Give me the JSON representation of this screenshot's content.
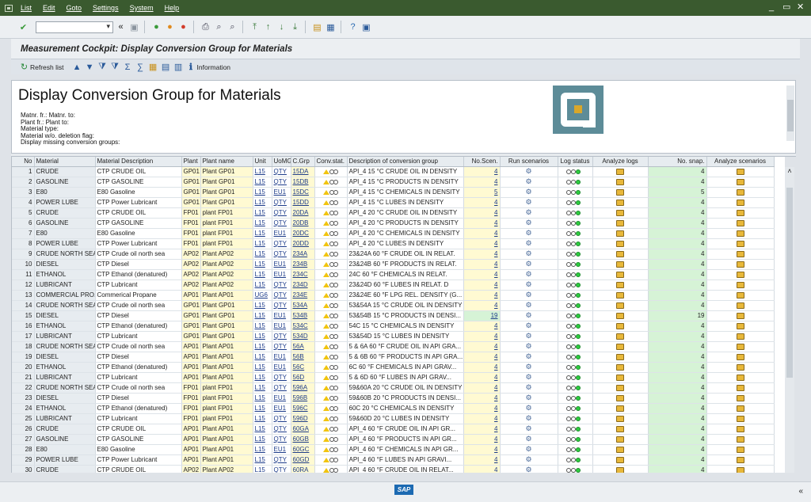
{
  "menu": [
    "List",
    "Edit",
    "Goto",
    "Settings",
    "System",
    "Help"
  ],
  "window_controls": [
    "_",
    "▭",
    "✕"
  ],
  "title": "Measurement Cockpit: Display Conversion Group for Materials",
  "app_toolbar": {
    "refresh": "Refresh list",
    "information": "Information"
  },
  "header": {
    "heading": "Display Conversion Group for Materials",
    "criteria": [
      "Matnr. fr.: Matnr. to:",
      "Plant fr.: Plant to:",
      "Material type:",
      "Material w/o. deletion flag:",
      "Display missing conversion groups:"
    ]
  },
  "columns": [
    "No",
    "Material",
    "Material Description",
    "Plant",
    "Plant name",
    "Unit",
    "UoMG",
    "C.Grp",
    "Conv.stat.",
    "Description of conversion group",
    "No.Scen.",
    "Run scenarios",
    "Log status",
    "Analyze logs",
    "No. snap.",
    "Analyze scenarios"
  ],
  "rows": [
    [
      "1",
      "CRUDE",
      "CTP CRUDE OIL",
      "GP01",
      "Plant GP01",
      "L15",
      "QTY",
      "15DA",
      "API_4  15 °C CRUDE OIL  IN DENSITY",
      "4",
      "4"
    ],
    [
      "2",
      "GASOLINE",
      "CTP GASOLINE",
      "GP01",
      "Plant GP01",
      "L15",
      "QTY",
      "15DB",
      "API_4  15 °C PRODUCTS  IN DENSITY",
      "4",
      "4"
    ],
    [
      "3",
      "E80",
      "E80 Gasoline",
      "GP01",
      "Plant GP01",
      "L15",
      "EU1",
      "15DC",
      "API_4  15 °C CHEMICALS IN DENSITY",
      "5",
      "5"
    ],
    [
      "4",
      "POWER LUBE",
      "CTP Power Lubricant",
      "GP01",
      "Plant GP01",
      "L15",
      "QTY",
      "15DD",
      "API_4  15 °C LUBES     IN DENSITY",
      "4",
      "4"
    ],
    [
      "5",
      "CRUDE",
      "CTP CRUDE OIL",
      "FP01",
      "plant FP01",
      "L15",
      "QTY",
      "20DA",
      "API_4  20 °C CRUDE OIL  IN DENSITY",
      "4",
      "4"
    ],
    [
      "6",
      "GASOLINE",
      "CTP GASOLINE",
      "FP01",
      "plant FP01",
      "L15",
      "QTY",
      "20DB",
      "API_4  20 °C PRODUCTS  IN DENSITY",
      "4",
      "4"
    ],
    [
      "7",
      "E80",
      "E80 Gasoline",
      "FP01",
      "plant FP01",
      "L15",
      "EU1",
      "20DC",
      "API_4  20 °C CHEMICALS IN DENSITY",
      "4",
      "4"
    ],
    [
      "8",
      "POWER LUBE",
      "CTP Power Lubricant",
      "FP01",
      "plant FP01",
      "L15",
      "QTY",
      "20DD",
      "API_4  20 °C LUBES     IN DENSITY",
      "4",
      "4"
    ],
    [
      "9",
      "CRUDE NORTH SEA",
      "CTP Crude oil north sea",
      "AP02",
      "Plant AP02",
      "L15",
      "QTY",
      "234A",
      "23&24A 60 °F CRUDE OIL  IN RELAT.",
      "4",
      "4"
    ],
    [
      "10",
      "DIESEL",
      "CTP Diesel",
      "AP02",
      "Plant AP02",
      "L15",
      "EU1",
      "234B",
      "23&24B 60 °F PRODUCTS   IN RELAT.",
      "4",
      "4"
    ],
    [
      "11",
      "ETHANOL",
      "CTP Ethanol (denatured)",
      "AP02",
      "Plant AP02",
      "L15",
      "EU1",
      "234C",
      "24C    60 °F CHEMICALS IN RELAT.",
      "4",
      "4"
    ],
    [
      "12",
      "LUBRICANT",
      "CTP Lubricant",
      "AP02",
      "Plant AP02",
      "L15",
      "QTY",
      "234D",
      "23&24D 60 °F LUBES      IN RELAT. D",
      "4",
      "4"
    ],
    [
      "13",
      "COMMERCIAL PRO...",
      "Commerical Propane",
      "AP01",
      "Plant AP01",
      "UG6",
      "QTY",
      "234E",
      "23&24E 60 °F LPG REL. DENSITY (G...",
      "4",
      "4"
    ],
    [
      "14",
      "CRUDE NORTH SEA",
      "CTP Crude oil north sea",
      "GP01",
      "Plant GP01",
      "L15",
      "QTY",
      "534A",
      "53&54A 15 °C CRUDE OIL IN DENSITY",
      "4",
      "4"
    ],
    [
      "15",
      "DIESEL",
      "CTP Diesel",
      "GP01",
      "Plant GP01",
      "L15",
      "EU1",
      "534B",
      "53&54B 15 °C PRODUCTS  IN DENSI...",
      "19",
      "19"
    ],
    [
      "16",
      "ETHANOL",
      "CTP Ethanol (denatured)",
      "GP01",
      "Plant GP01",
      "L15",
      "EU1",
      "534C",
      "54C    15 °C CHEMICALS IN DENSITY",
      "4",
      "4"
    ],
    [
      "17",
      "LUBRICANT",
      "CTP Lubricant",
      "GP01",
      "Plant GP01",
      "L15",
      "QTY",
      "534D",
      "53&54D 15 °C LUBES     IN DENSITY",
      "4",
      "4"
    ],
    [
      "18",
      "CRUDE NORTH SEA",
      "CTP Crude oil north sea",
      "AP01",
      "Plant AP01",
      "L15",
      "QTY",
      "56A",
      "5 & 6A 60 °F CRUDE OIL IN API GRA...",
      "4",
      "4"
    ],
    [
      "19",
      "DIESEL",
      "CTP Diesel",
      "AP01",
      "Plant AP01",
      "L15",
      "EU1",
      "56B",
      "5 & 6B 60 °F PRODUCTS  IN API GRA...",
      "4",
      "4"
    ],
    [
      "20",
      "ETHANOL",
      "CTP Ethanol (denatured)",
      "AP01",
      "Plant AP01",
      "L15",
      "EU1",
      "56C",
      "6C     60 °F CHEMICALS IN API GRAV...",
      "4",
      "4"
    ],
    [
      "21",
      "LUBRICANT",
      "CTP Lubricant",
      "AP01",
      "Plant AP01",
      "L15",
      "QTY",
      "56D",
      "5 & 6D 60 °F LUBES     IN API GRAV...",
      "4",
      "4"
    ],
    [
      "22",
      "CRUDE NORTH SEA",
      "CTP Crude oil north sea",
      "FP01",
      "plant FP01",
      "L15",
      "QTY",
      "596A",
      "59&60A 20 °C CRUDE OIL IN DENSITY",
      "4",
      "4"
    ],
    [
      "23",
      "DIESEL",
      "CTP Diesel",
      "FP01",
      "plant FP01",
      "L15",
      "EU1",
      "596B",
      "59&60B 20 °C PRODUCTS  IN DENSI...",
      "4",
      "4"
    ],
    [
      "24",
      "ETHANOL",
      "CTP Ethanol (denatured)",
      "FP01",
      "plant FP01",
      "L15",
      "EU1",
      "596C",
      "60C    20 °C CHEMICALS IN DENSITY",
      "4",
      "4"
    ],
    [
      "25",
      "LUBRICANT",
      "CTP Lubricant",
      "FP01",
      "plant FP01",
      "L15",
      "QTY",
      "596D",
      "59&60D 20 °C LUBES     IN DENSITY",
      "4",
      "4"
    ],
    [
      "26",
      "CRUDE",
      "CTP CRUDE OIL",
      "AP01",
      "Plant AP01",
      "L15",
      "QTY",
      "60GA",
      "API_4  60 °F CRUDE OIL  IN API GR...",
      "4",
      "4"
    ],
    [
      "27",
      "GASOLINE",
      "CTP GASOLINE",
      "AP01",
      "Plant AP01",
      "L15",
      "QTY",
      "60GB",
      "API_4  60 °F PRODUCTS  IN API GR...",
      "4",
      "4"
    ],
    [
      "28",
      "E80",
      "E80 Gasoline",
      "AP01",
      "Plant AP01",
      "L15",
      "EU1",
      "60GC",
      "API_4  60 °F CHEMICALS IN API GR...",
      "4",
      "4"
    ],
    [
      "29",
      "POWER LUBE",
      "CTP Power Lubricant",
      "AP01",
      "Plant AP01",
      "L15",
      "QTY",
      "60GD",
      "API_4  60 °F LUBES     IN API GRAVI...",
      "4",
      "4"
    ],
    [
      "30",
      "CRUDE",
      "CTP CRUDE OIL",
      "AP02",
      "Plant AP02",
      "L15",
      "QTY",
      "60RA",
      "API_4  60 °F CRUDE OIL  IN RELAT...",
      "4",
      "4"
    ]
  ],
  "footer": {
    "logo": "SAP",
    "collapse": "«"
  }
}
